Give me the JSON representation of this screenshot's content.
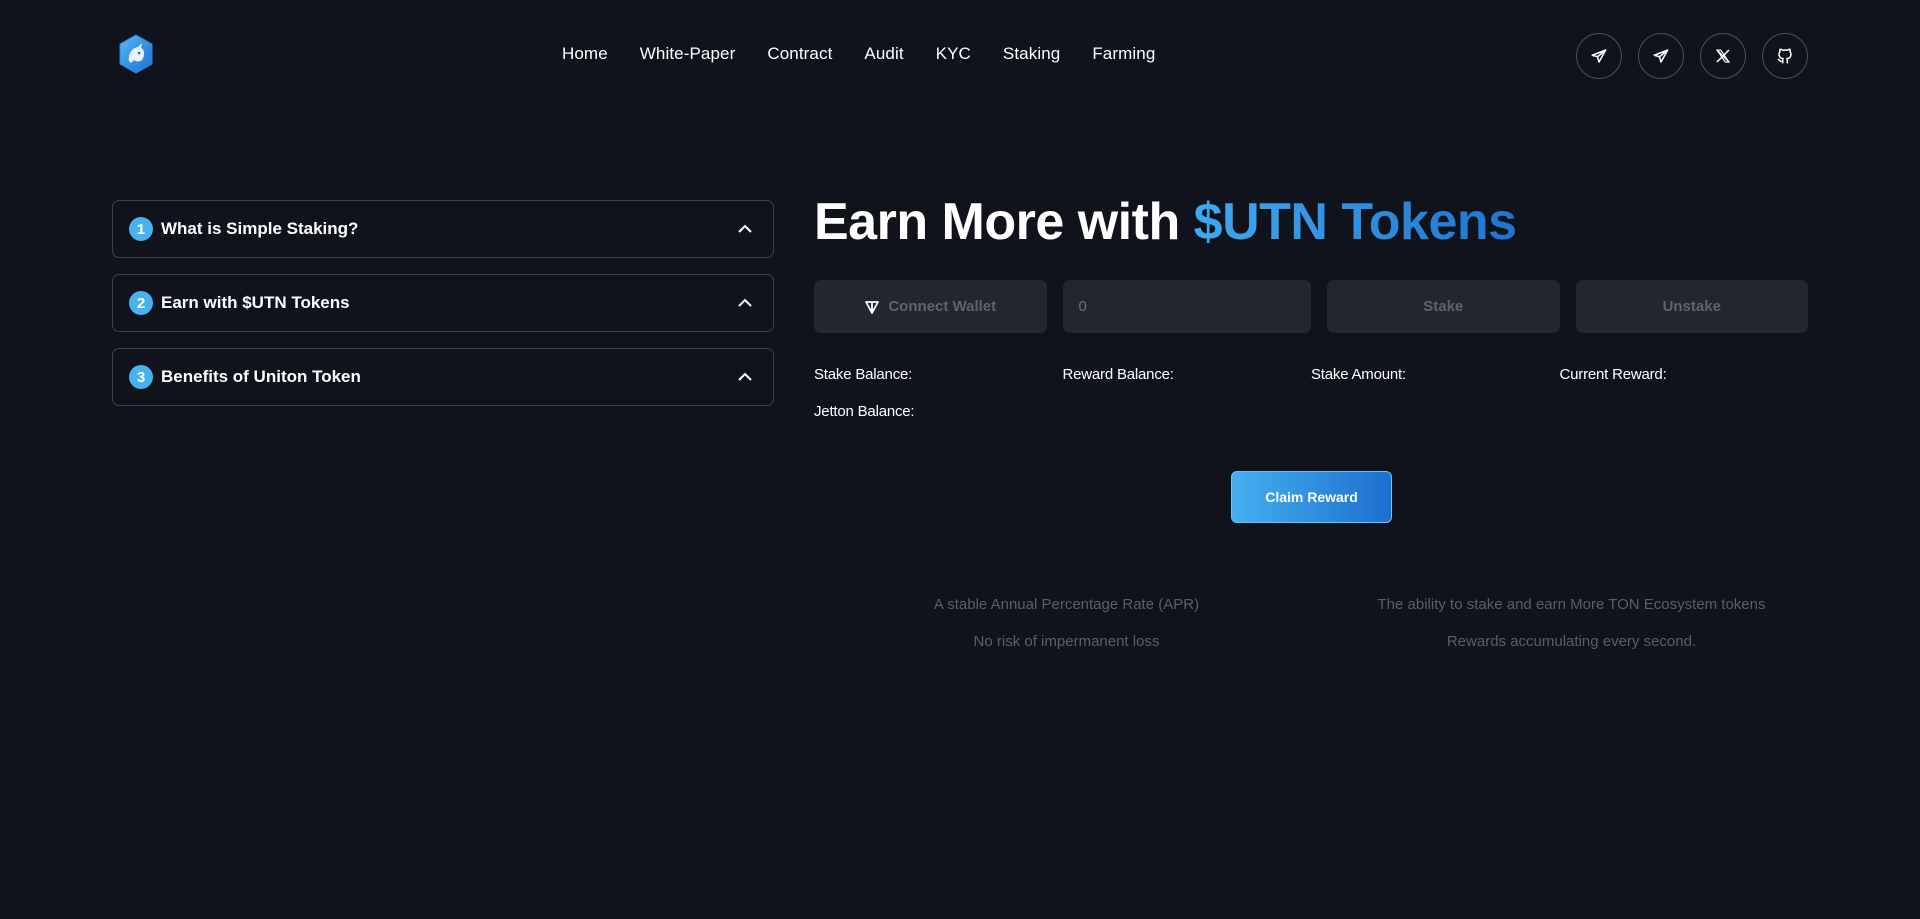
{
  "header": {
    "logo_icon": "unicorn-hexagon-logo",
    "nav": [
      {
        "label": "Home"
      },
      {
        "label": "White-Paper"
      },
      {
        "label": "Contract"
      },
      {
        "label": "Audit"
      },
      {
        "label": "KYC"
      },
      {
        "label": "Staking"
      },
      {
        "label": "Farming"
      }
    ],
    "socials": [
      {
        "icon": "telegram-icon"
      },
      {
        "icon": "telegram-icon"
      },
      {
        "icon": "x-twitter-icon"
      },
      {
        "icon": "github-icon"
      }
    ]
  },
  "accordion": [
    {
      "number": "1",
      "title": "What is Simple Staking?"
    },
    {
      "number": "2",
      "title": "Earn with $UTN Tokens"
    },
    {
      "number": "3",
      "title": "Benefits of Uniton Token"
    }
  ],
  "hero": {
    "title_white": "Earn More with ",
    "title_blue": "$UTN Tokens"
  },
  "controls": {
    "connect_wallet": "Connect Wallet",
    "amount_value": "0",
    "stake": "Stake",
    "unstake": "Unstake"
  },
  "stats": {
    "stake_balance": "Stake Balance:",
    "reward_balance": "Reward Balance:",
    "stake_amount": "Stake Amount:",
    "current_reward": "Current Reward:",
    "jetton_balance": "Jetton Balance:"
  },
  "claim_label": "Claim Reward",
  "benefits": [
    "A stable Annual Percentage Rate (APR)",
    "The ability to stake and earn More TON Ecosystem tokens",
    "No risk of impermanent loss",
    "Rewards accumulating every second."
  ],
  "colors": {
    "background": "#10131b",
    "accent": "#46b3ee",
    "accent_dark": "#1c6fce",
    "panel": "#222630"
  }
}
